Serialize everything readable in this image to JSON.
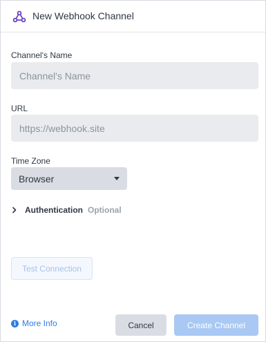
{
  "header": {
    "title": "New Webhook Channel",
    "icon": "webhook-icon"
  },
  "form": {
    "name": {
      "label": "Channel's Name",
      "placeholder": "Channel's Name",
      "value": ""
    },
    "url": {
      "label": "URL",
      "placeholder": "https://webhook.site",
      "value": ""
    },
    "timezone": {
      "label": "Time Zone",
      "selected": "Browser"
    },
    "authentication": {
      "label": "Authentication",
      "optional": "Optional"
    },
    "test_connection": "Test Connection"
  },
  "footer": {
    "more_info": "More Info",
    "cancel": "Cancel",
    "create": "Create Channel"
  },
  "colors": {
    "accent": "#2f7de1",
    "primary_disabled": "#a9c8f3",
    "icon_purple": "#6b3fc7"
  }
}
